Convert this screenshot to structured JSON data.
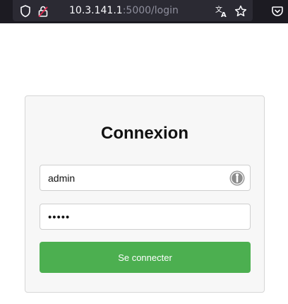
{
  "browser": {
    "url_host": "10.3.141.1",
    "url_rest": ":5000/login",
    "icons": [
      "shield-icon",
      "lock-icon",
      "translate-icon",
      "bookmark-star-icon",
      "pocket-icon"
    ]
  },
  "login": {
    "title": "Connexion",
    "username_value": "admin",
    "password_value": "•••••",
    "submit_label": "Se connecter"
  },
  "colors": {
    "button": "#4caf50",
    "toolbar": "#1c1b22"
  }
}
